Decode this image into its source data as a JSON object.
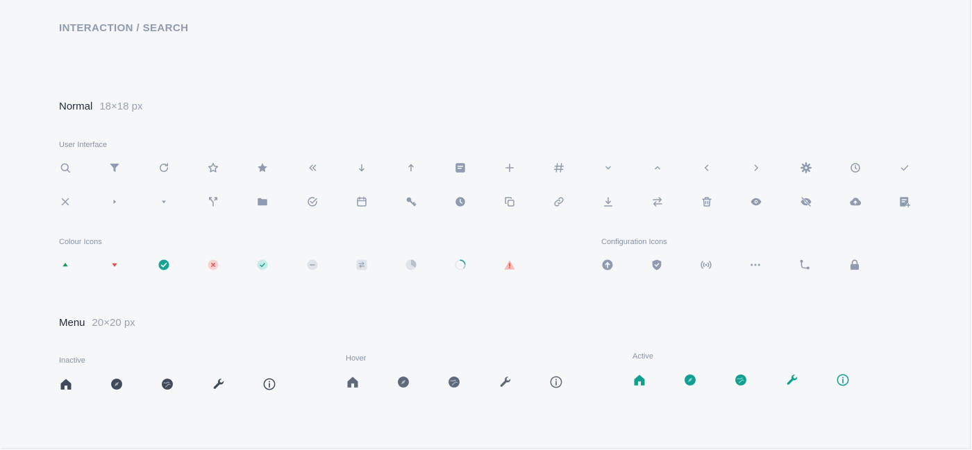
{
  "page": {
    "title": "INTERACTION / SEARCH"
  },
  "colors": {
    "icon_gray": "#8e9bb0",
    "heading": "#1e2a3b",
    "teal": "#14a394",
    "green": "#1f9d55",
    "red": "#e3554a",
    "menu_inactive": "#3f4a5c",
    "menu_hover": "#5e6a7c",
    "menu_active": "#0fa190"
  },
  "normal": {
    "title": "Normal",
    "size": "18×18 px",
    "ui_label": "User Interface",
    "ui_row1": [
      "search-icon",
      "filter-icon",
      "refresh-icon",
      "star-outline-icon",
      "star-filled-icon",
      "double-chevron-left-icon",
      "arrow-down-icon",
      "arrow-up-icon",
      "note-icon",
      "plus-icon",
      "hash-icon",
      "chevron-down-icon",
      "chevron-up-icon",
      "chevron-left-icon",
      "chevron-right-icon",
      "gear-icon",
      "clock-outline-icon",
      "check-icon"
    ],
    "ui_row2": [
      "close-icon",
      "caret-right-icon",
      "caret-down-icon",
      "merge-icon",
      "folder-icon",
      "check-circle-outline-icon",
      "calendar-icon",
      "key-icon",
      "clock-filled-icon",
      "copy-icon",
      "link-icon",
      "download-icon",
      "swap-icon",
      "trash-icon",
      "eye-icon",
      "eye-off-icon",
      "cloud-upload-icon",
      "note-add-icon"
    ],
    "colour_label": "Colour Icons",
    "colour_icons": [
      "triangle-up-green-icon",
      "triangle-down-red-icon",
      "check-circle-teal-icon",
      "x-circle-red-icon",
      "check-circle-light-icon",
      "minus-circle-gray-icon",
      "swap-square-gray-icon",
      "pie-partial-icon",
      "spinner-icon",
      "warning-icon"
    ],
    "config_label": "Configuration Icons",
    "config_icons": [
      "arrow-up-circle-icon",
      "shield-check-icon",
      "broadcast-icon",
      "more-dots-icon",
      "route-icon",
      "lock-icon"
    ]
  },
  "menu": {
    "title": "Menu",
    "size": "20×20 px",
    "inactive_label": "Inactive",
    "hover_label": "Hover",
    "active_label": "Active",
    "icons": [
      "home-icon",
      "compass-icon",
      "globe-icon",
      "wrench-icon",
      "info-icon"
    ]
  }
}
